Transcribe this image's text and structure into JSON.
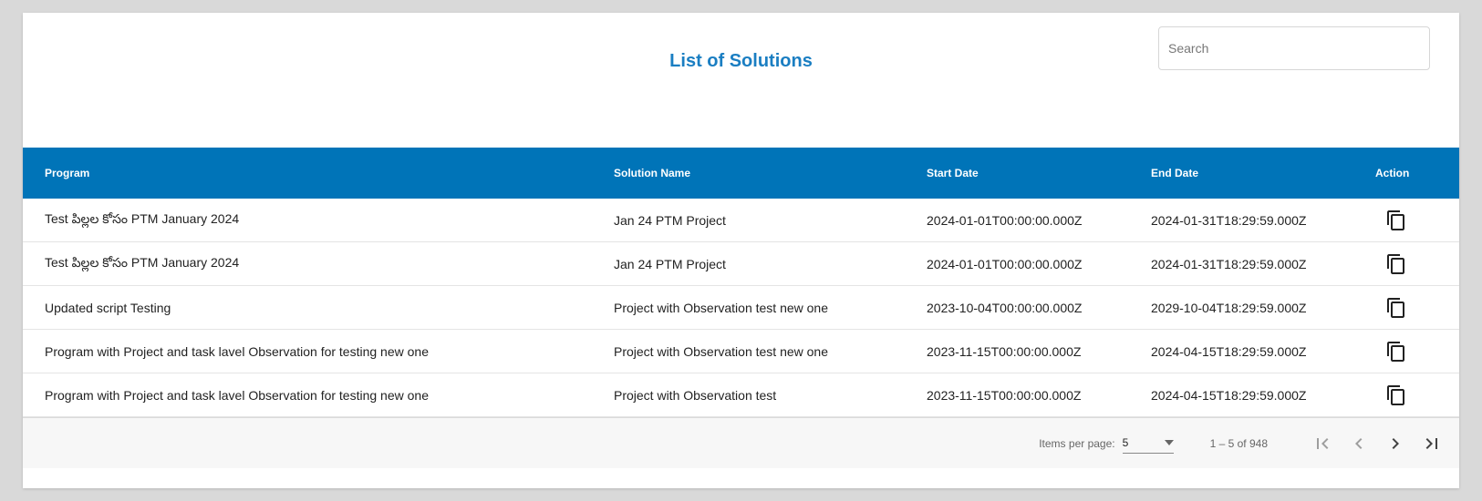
{
  "header": {
    "title": "List of Solutions",
    "search_placeholder": "Search"
  },
  "table": {
    "columns": {
      "program": "Program",
      "solution": "Solution Name",
      "start": "Start Date",
      "end": "End Date",
      "action": "Action"
    },
    "rows": [
      {
        "program": "Test పిల్లల కోసం PTM January 2024",
        "solution": "Jan 24 PTM Project",
        "start": "2024-01-01T00:00:00.000Z",
        "end": "2024-01-31T18:29:59.000Z",
        "action_icon": "copy-icon"
      },
      {
        "program": "Test పిల్లల కోసం PTM January 2024",
        "solution": "Jan 24 PTM Project",
        "start": "2024-01-01T00:00:00.000Z",
        "end": "2024-01-31T18:29:59.000Z",
        "action_icon": "copy-icon"
      },
      {
        "program": "Updated script Testing",
        "solution": "Project with Observation test new one",
        "start": "2023-10-04T00:00:00.000Z",
        "end": "2029-10-04T18:29:59.000Z",
        "action_icon": "copy-icon"
      },
      {
        "program": "Program with Project and task lavel Observation for testing new one",
        "solution": "Project with Observation test new one",
        "start": "2023-11-15T00:00:00.000Z",
        "end": "2024-04-15T18:29:59.000Z",
        "action_icon": "copy-icon"
      },
      {
        "program": "Program with Project and task lavel Observation for testing new one",
        "solution": "Project with Observation test",
        "start": "2023-11-15T00:00:00.000Z",
        "end": "2024-04-15T18:29:59.000Z",
        "action_icon": "copy-icon"
      }
    ]
  },
  "paginator": {
    "items_per_page_label": "Items per page:",
    "items_per_page_value": "5",
    "range_label": "1 – 5 of 948"
  },
  "colors": {
    "accent": "#0074b8",
    "title": "#1a7ec2"
  }
}
